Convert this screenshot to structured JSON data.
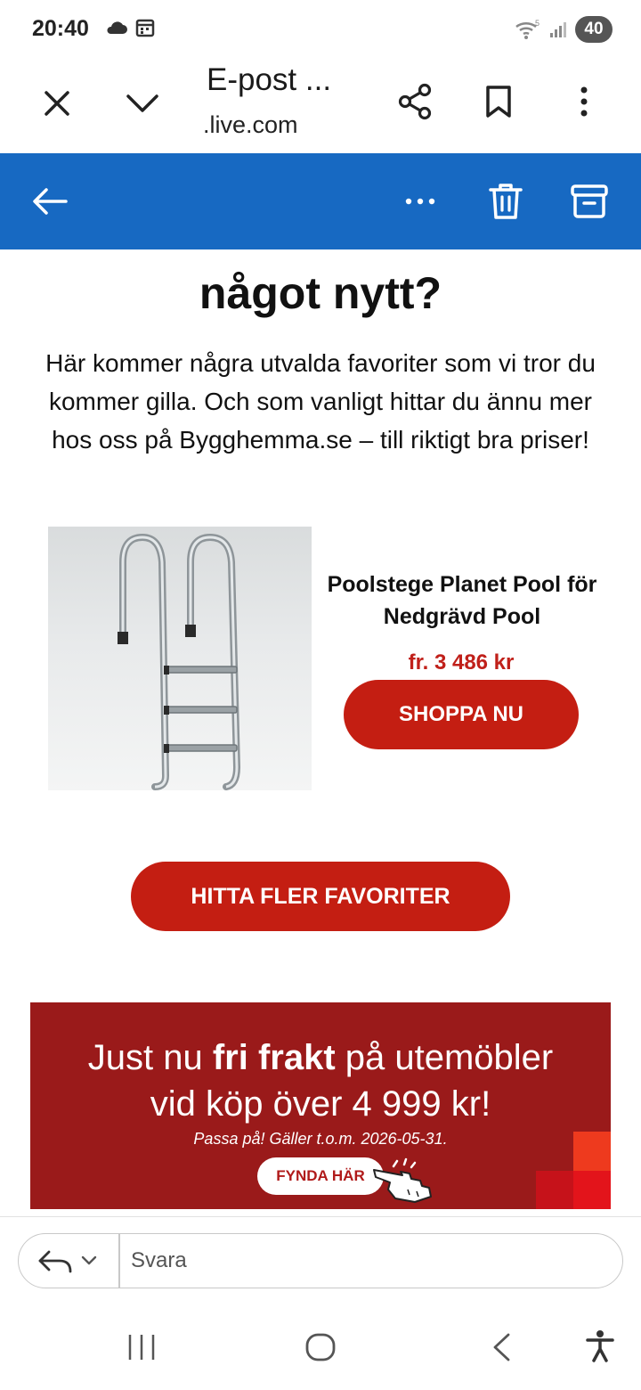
{
  "status": {
    "time": "20:40",
    "battery": "40",
    "network_label": "5"
  },
  "browser": {
    "title": "E-post ...",
    "url": ".live.com"
  },
  "email": {
    "heading": "något nytt?",
    "intro": "Här kommer några utvalda favoriter som vi tror du kommer gilla. Och som vanligt hittar du ännu mer hos oss på Bygghemma.se – till riktigt bra priser!",
    "product": {
      "name": "Poolstege Planet Pool för Nedgrävd Pool",
      "price": "fr. 3 486 kr",
      "button": "SHOPPA NU"
    },
    "more_button": "HITTA FLER FAVORITER",
    "banner": {
      "line1_prefix": "Just nu ",
      "line1_bold": "fri frakt",
      "line1_suffix": " på utemöbler",
      "line2": "vid köp över 4 999 kr!",
      "note": "Passa på! Gäller t.o.m. 2026-05-31.",
      "button": "FYNDA HÄR"
    }
  },
  "reply": {
    "placeholder": "Svara"
  },
  "colors": {
    "outlook_blue": "#1769c2",
    "brand_red": "#c41e12",
    "banner_red": "#9a1a1a",
    "price_red": "#c0201a"
  }
}
